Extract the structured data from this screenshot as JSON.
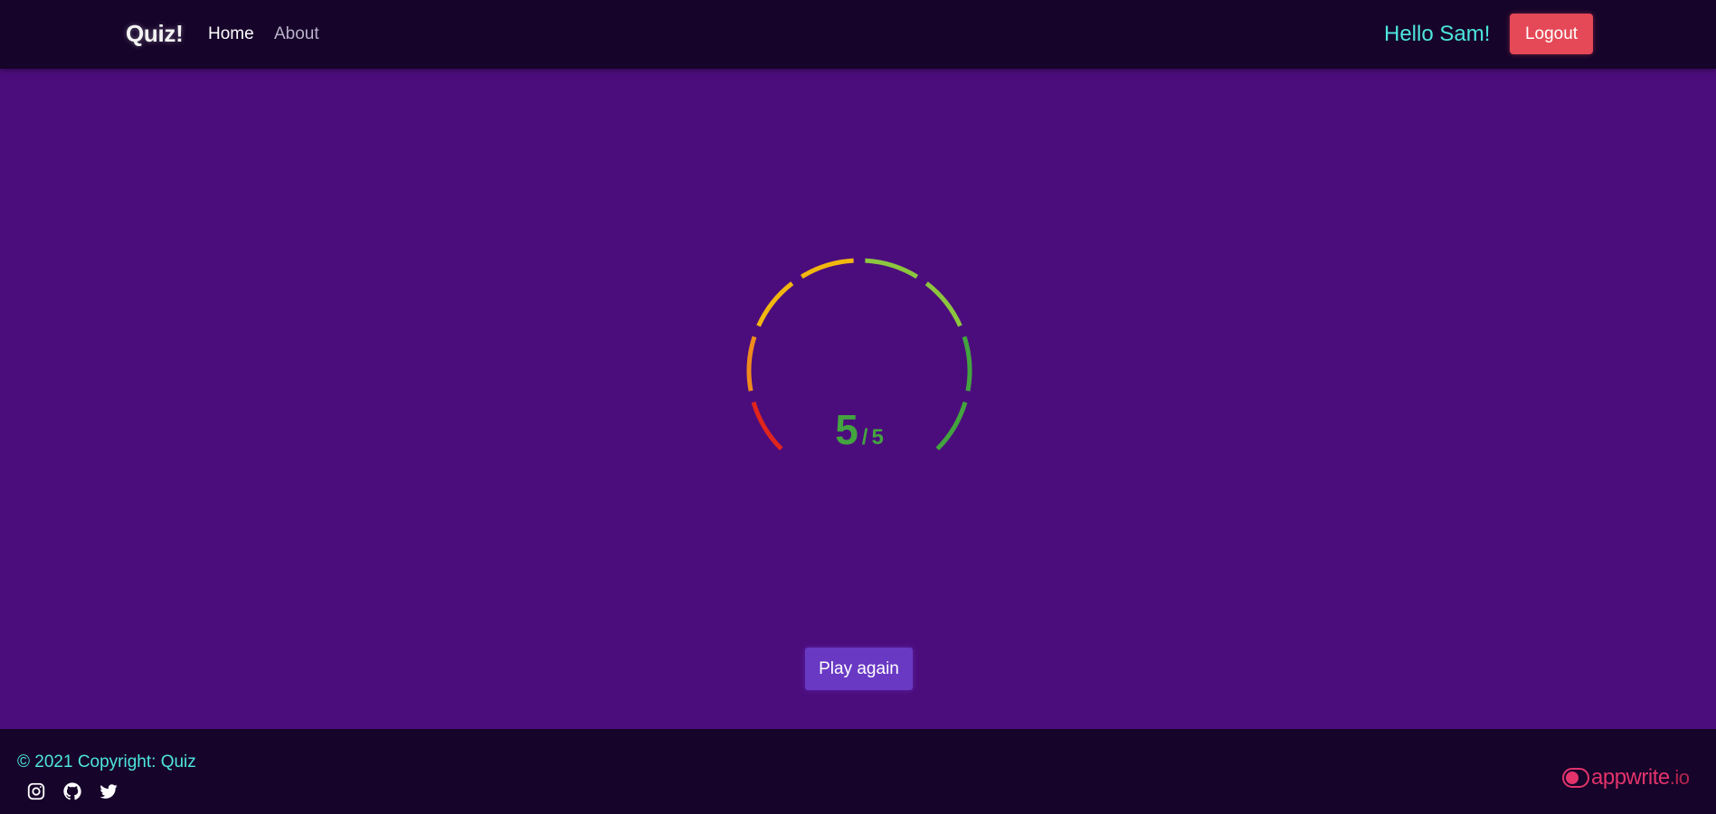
{
  "navbar": {
    "brand": "Quiz!",
    "links": [
      {
        "label": "Home"
      },
      {
        "label": "About"
      }
    ],
    "greeting": "Hello Sam!",
    "logout_label": "Logout"
  },
  "result": {
    "score": "5",
    "separator": "/",
    "total": "5",
    "max_score": 5,
    "gauge_colors": [
      "#e0251c",
      "#f08a1c",
      "#f2b70f",
      "#8cc63f",
      "#43a43f"
    ],
    "score_color": "#43a43f"
  },
  "play_again_label": "Play again",
  "footer": {
    "copyright": "© 2021 Copyright: Quiz",
    "social_icons": [
      "instagram-icon",
      "github-icon",
      "twitter-icon"
    ],
    "powered_by": {
      "name": "appwrite",
      "tld": ".io"
    }
  },
  "colors": {
    "background": "#4c0d7c",
    "navbar": "#16042a",
    "accent": "#4ee6dd",
    "logout": "#e54856",
    "play_button": "#6939c4",
    "appwrite": "#e2336b"
  }
}
